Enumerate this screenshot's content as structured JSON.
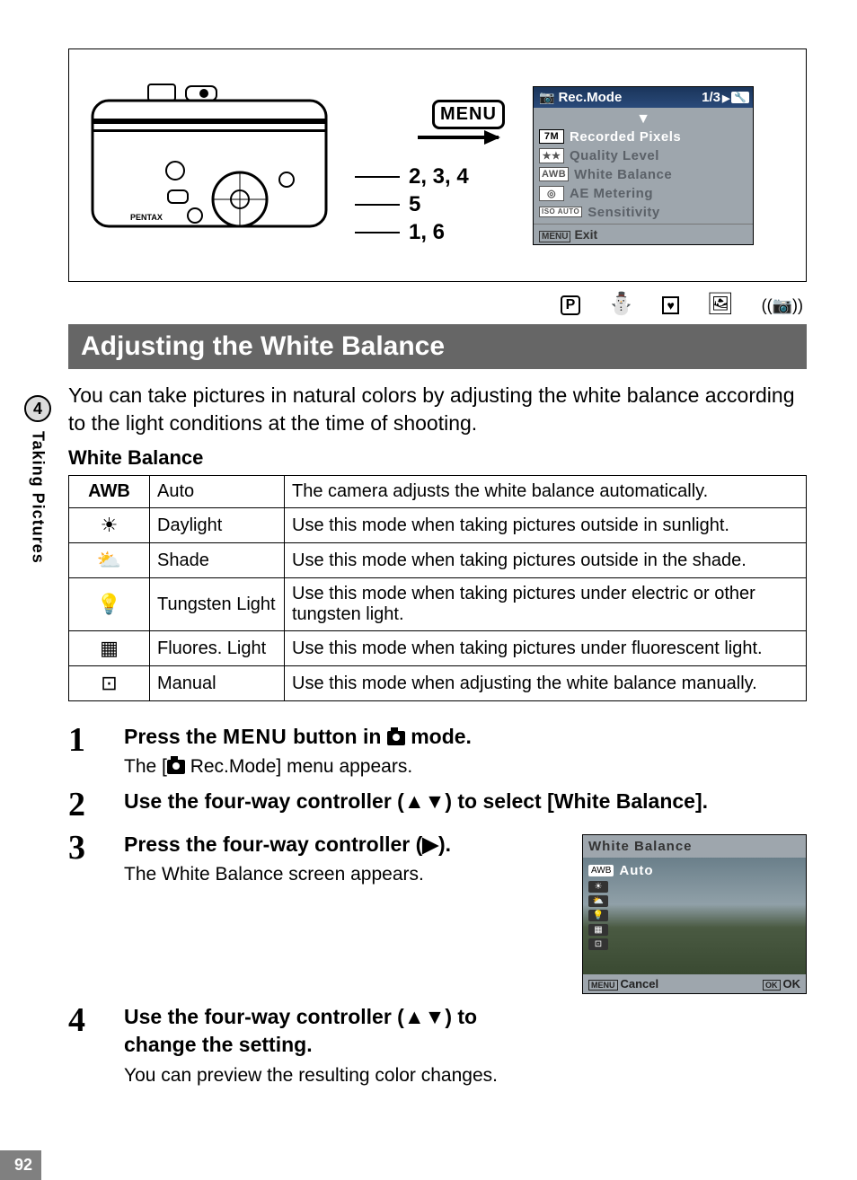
{
  "side": {
    "chapter_num": "4",
    "chapter_label": "Taking Pictures"
  },
  "page_number": "92",
  "diagram": {
    "menu_button": "MENU",
    "refs": [
      "2, 3, 4",
      "5",
      "1, 6"
    ],
    "lcd": {
      "title": "Rec.Mode",
      "page": "1/3",
      "items": [
        {
          "tag": "7M",
          "label": "Recorded Pixels"
        },
        {
          "tag": "★★",
          "label": "Quality Level"
        },
        {
          "tag": "AWB",
          "label": "White Balance"
        },
        {
          "tag": "◎",
          "label": "AE Metering"
        },
        {
          "tag": "ISO\nAUTO",
          "label": "Sensitivity"
        }
      ],
      "exit_btn": "MENU",
      "exit_label": "Exit"
    }
  },
  "mode_icons": [
    "P",
    "⛄",
    "♥",
    "🖼",
    "((📷))"
  ],
  "heading": "Adjusting the White Balance",
  "intro": "You can take pictures in natural colors by adjusting the white balance according to the light conditions at the time of shooting.",
  "subhead": "White Balance",
  "table": [
    {
      "icon": "AWB",
      "name": "Auto",
      "desc": "The camera adjusts the white balance automatically."
    },
    {
      "icon": "☀",
      "name": "Daylight",
      "desc": "Use this mode when taking pictures outside in sunlight."
    },
    {
      "icon": "⛅",
      "name": "Shade",
      "desc": "Use this mode when taking pictures outside in the shade."
    },
    {
      "icon": "💡",
      "name": "Tungsten Light",
      "desc": "Use this mode when taking pictures under electric or other tungsten light."
    },
    {
      "icon": "▦",
      "name": "Fluores. Light",
      "desc": "Use this mode when taking pictures under fluorescent light."
    },
    {
      "icon": "⊡",
      "name": "Manual",
      "desc": "Use this mode when adjusting the white balance manually."
    }
  ],
  "steps": [
    {
      "num": "1",
      "title_pre": "Press the ",
      "title_menu": "MENU",
      "title_mid": " button in ",
      "title_post": " mode.",
      "desc_pre": "The [",
      "desc_post": " Rec.Mode] menu appears."
    },
    {
      "num": "2",
      "title": "Use the four-way controller (▲▼) to select [White Balance]."
    },
    {
      "num": "3",
      "title": "Press the four-way controller (▶).",
      "desc": "The White Balance screen appears."
    },
    {
      "num": "4",
      "title": "Use the four-way controller (▲▼) to change the setting.",
      "desc": "You can preview the resulting color changes."
    }
  ],
  "wb_preview": {
    "title": "White Balance",
    "options": [
      {
        "tag": "AWB",
        "label": "Auto",
        "selected": true
      },
      {
        "tag": "☀"
      },
      {
        "tag": "⛅"
      },
      {
        "tag": "💡"
      },
      {
        "tag": "▦"
      },
      {
        "tag": "⊡"
      }
    ],
    "cancel_btn": "MENU",
    "cancel": "Cancel",
    "ok_btn": "OK",
    "ok": "OK"
  }
}
